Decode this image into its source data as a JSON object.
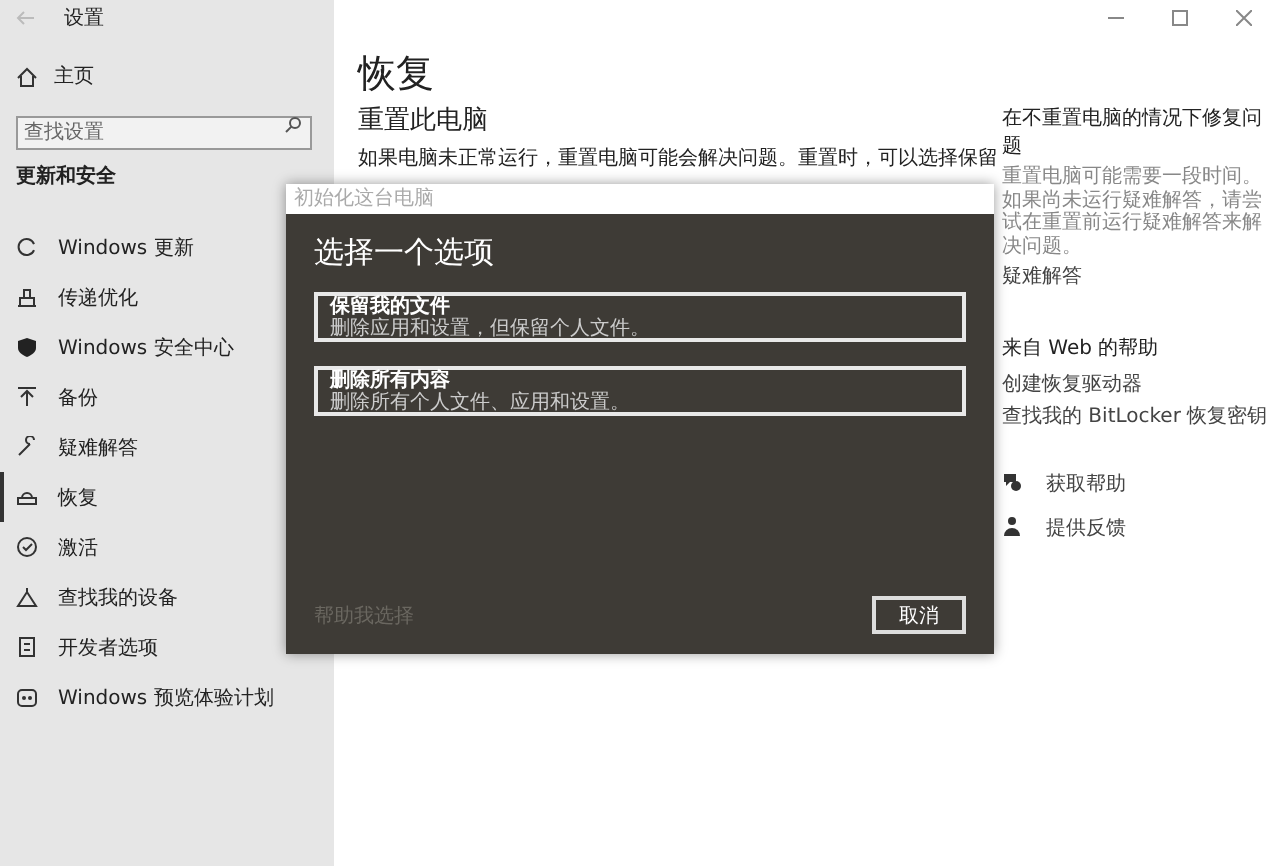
{
  "window": {
    "title": "设置"
  },
  "sidebar": {
    "home": "主页",
    "search": {
      "placeholder": "查找设置"
    },
    "section": "更新和安全",
    "items": [
      {
        "label": "Windows 更新",
        "selected": false
      },
      {
        "label": "传递优化",
        "selected": false
      },
      {
        "label": "Windows 安全中心",
        "selected": false
      },
      {
        "label": "备份",
        "selected": false
      },
      {
        "label": "疑难解答",
        "selected": false
      },
      {
        "label": "恢复",
        "selected": true
      },
      {
        "label": "激活",
        "selected": false
      },
      {
        "label": "查找我的设备",
        "selected": false
      },
      {
        "label": "开发者选项",
        "selected": false
      },
      {
        "label": "Windows 预览体验计划",
        "selected": false
      }
    ]
  },
  "main": {
    "title": "恢复",
    "subtitle": "重置此电脑",
    "paragraph": "如果电脑未正常运行，重置电脑可能会解决问题。重置时，可以选择保留"
  },
  "right_panel": {
    "heading": "在不重置电脑的情况下修复问题",
    "text": "重置电脑可能需要一段时间。如果尚未运行疑难解答，请尝试在重置前运行疑难解答来解决问题。",
    "link": "疑难解答",
    "web_heading": "来自 Web 的帮助",
    "web_links": [
      "创建恢复驱动器",
      "查找我的 BitLocker 恢复密钥"
    ],
    "help_links": [
      "获取帮助",
      "提供反馈"
    ]
  },
  "dialog": {
    "title": "初始化这台电脑",
    "heading": "选择一个选项",
    "options": [
      {
        "title": "保留我的文件",
        "description": "删除应用和设置，但保留个人文件。"
      },
      {
        "title": "删除所有内容",
        "description": "删除所有个人文件、应用和设置。"
      }
    ],
    "help_link": {
      "label": "帮助我选择",
      "disabled": true
    },
    "cancel": "取消"
  }
}
